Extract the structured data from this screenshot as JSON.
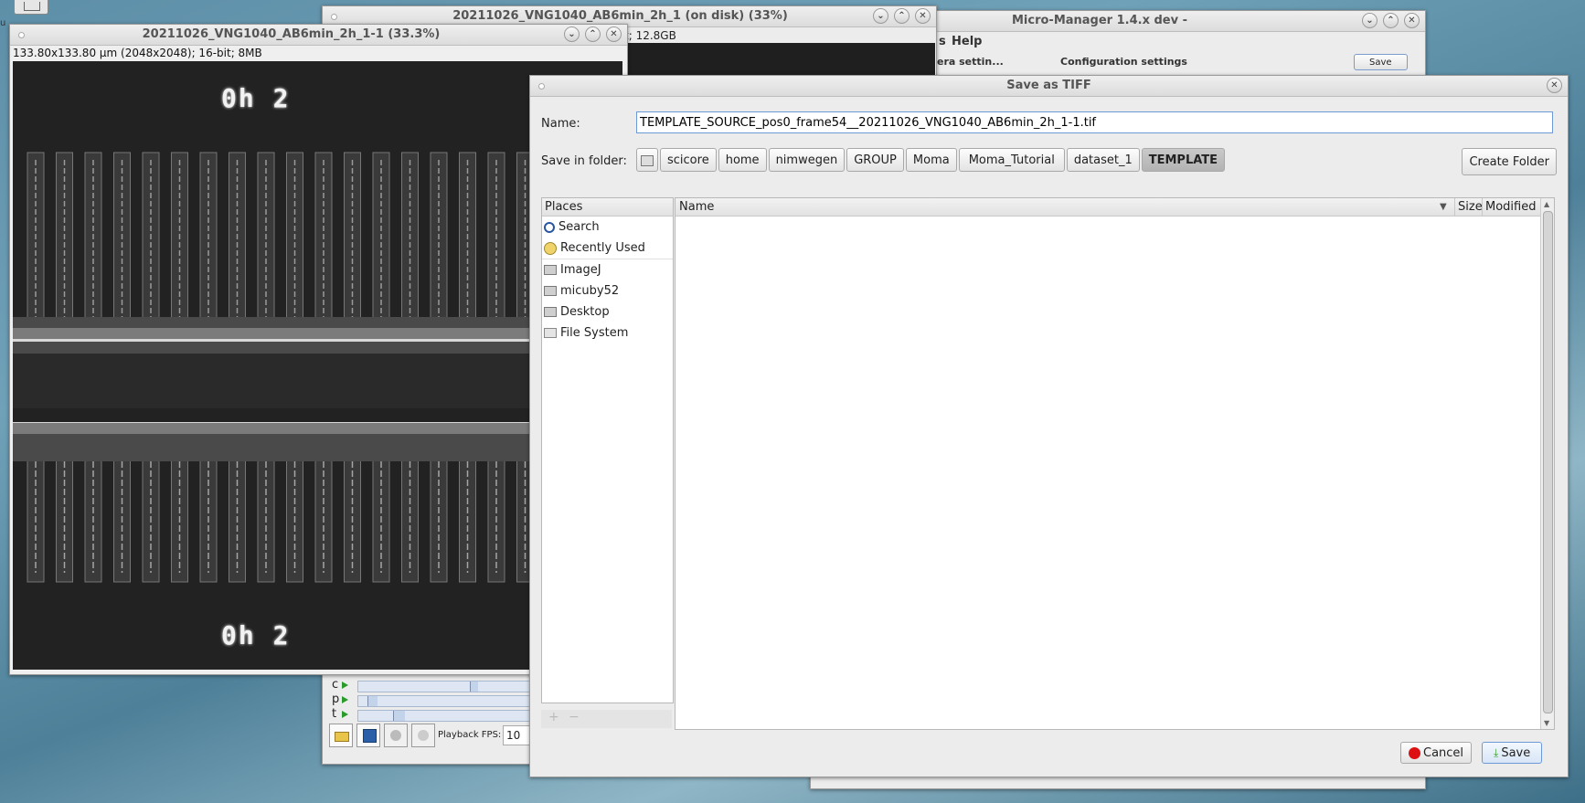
{
  "desktop": {
    "top_icon": "folder-icon"
  },
  "micromanager": {
    "title": "Micro-Manager 1.4.x dev -",
    "menu_help": "Help",
    "menu_partial": "s",
    "camera_settings": "era settin...",
    "config_settings": "Configuration settings",
    "save_label": "Save"
  },
  "disk_window": {
    "title": "20211026_VNG1040_AB6min_2h_1 (on disk) (33%)",
    "info": "t; 12.8GB",
    "sliders": [
      {
        "label": "c"
      },
      {
        "label": "p"
      },
      {
        "label": "t"
      }
    ],
    "playback_label": "Playback FPS:",
    "playback_value": "10"
  },
  "image_window": {
    "title": "20211026_VNG1040_AB6min_2h_1-1 (33.3%)",
    "info": "133.80x133.80 µm (2048x2048); 16-bit; 8MB",
    "overlay_top": "0h 2",
    "overlay_bottom": "0h 2"
  },
  "dialog": {
    "title": "Save as TIFF",
    "name_label": "Name:",
    "name_value": "TEMPLATE_SOURCE_pos0_frame54__20211026_VNG1040_AB6min_2h_1-1.tif",
    "folder_label": "Save in folder:",
    "path": [
      "scicore",
      "home",
      "nimwegen",
      "GROUP",
      "Moma",
      "Moma_Tutorial",
      "dataset_1",
      "TEMPLATE"
    ],
    "create_folder": "Create Folder",
    "places_header": "Places",
    "places": [
      {
        "label": "Search",
        "icon": "search-icon"
      },
      {
        "label": "Recently Used",
        "icon": "clock-icon"
      },
      {
        "label": "ImageJ",
        "icon": "folder-icon"
      },
      {
        "label": "micuby52",
        "icon": "home-folder-icon"
      },
      {
        "label": "Desktop",
        "icon": "desktop-folder-icon"
      },
      {
        "label": "File System",
        "icon": "drive-icon"
      }
    ],
    "add_symbol": "+",
    "remove_symbol": "−",
    "columns": {
      "name": "Name",
      "size": "Size",
      "modified": "Modified"
    },
    "cancel": "Cancel",
    "save": "Save"
  },
  "colors": {
    "accent": "#3a78c8",
    "cancel_icon": "#dd1111",
    "save_icon": "#3a9a2a"
  }
}
